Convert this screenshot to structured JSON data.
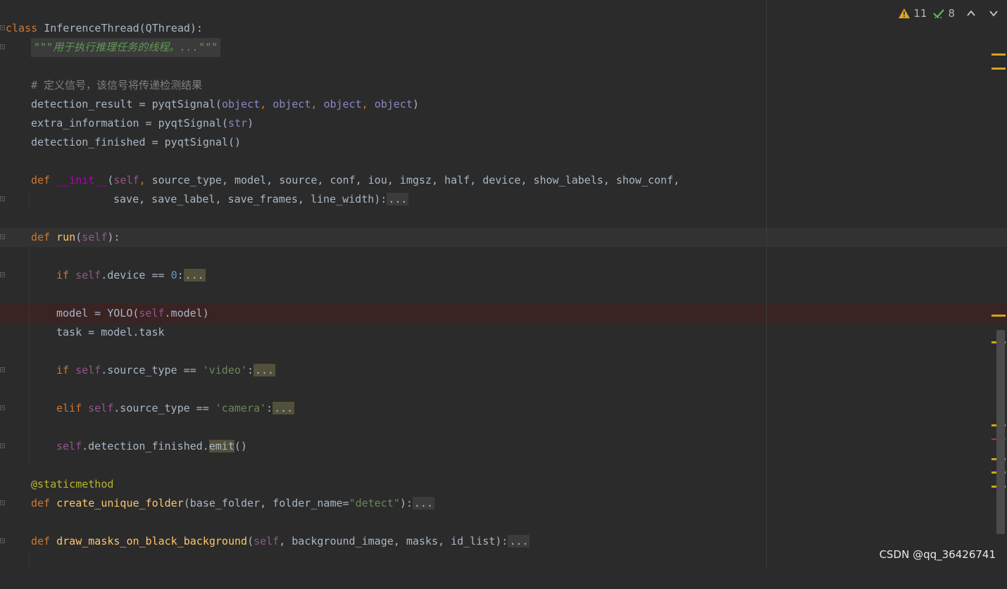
{
  "indicators": {
    "warnings": "11",
    "weak_warnings": "8"
  },
  "code": {
    "class_kw": "class",
    "class_name": "InferenceThread",
    "class_base": "(QThread):",
    "docstring": "\"\"\"用于执行推理任务的线程。...\"\"\"",
    "comment": "# 定义信号，该信号将传递检测结果",
    "l4_name": "detection_result = pyqtSignal(",
    "l4_a1": "object",
    "l4_sep": ", ",
    "l4_close": ")",
    "l5_name": "extra_information = pyqtSignal(",
    "l5_arg": "str",
    "l5_close": ")",
    "l6": "detection_finished = pyqtSignal()",
    "def_kw": "def",
    "init_name": "__init__",
    "init_open": "(",
    "self": "self",
    "init_params1": "source_type, model, source, conf, iou, imgsz, half, device, show_labels, show_conf,",
    "init_params2": "save, save_label, save_frames, line_width):",
    "fold_dots": "...",
    "run_name": "run",
    "run_tail": "):",
    "if_kw": "if",
    "device_tail": ".device == ",
    "zero": "0",
    "colon": ":",
    "model_l1": "model = YOLO(",
    "model_self_tail": ".model)",
    "task_line": "task = model.task",
    "source_type_tail": ".source_type == ",
    "video_str": "'video'",
    "elif_kw": "elif",
    "camera_str": "'camera'",
    "detect_fin": ".detection_finished.",
    "emit": "emit",
    "emit_tail": "()",
    "decorator": "@staticmethod",
    "cuf_name": "create_unique_folder",
    "cuf_params": "(base_folder, folder_name=",
    "detect_str": "\"detect\"",
    "cuf_tail": "):",
    "dm_name": "draw_masks_on_black_background",
    "dm_open": "(",
    "dm_params": ", background_image, masks, id_list):"
  },
  "watermark": "CSDN @qq_36426741",
  "colors": {
    "background": "#2b2b2b",
    "keyword": "#cc7832",
    "function": "#ffc66d",
    "self": "#94558d",
    "string": "#6a8759",
    "warning_mark": "#d4a21c"
  },
  "icons": [
    "warning-icon",
    "check-icon",
    "chevron-up-icon",
    "chevron-down-icon",
    "fold-icon"
  ]
}
